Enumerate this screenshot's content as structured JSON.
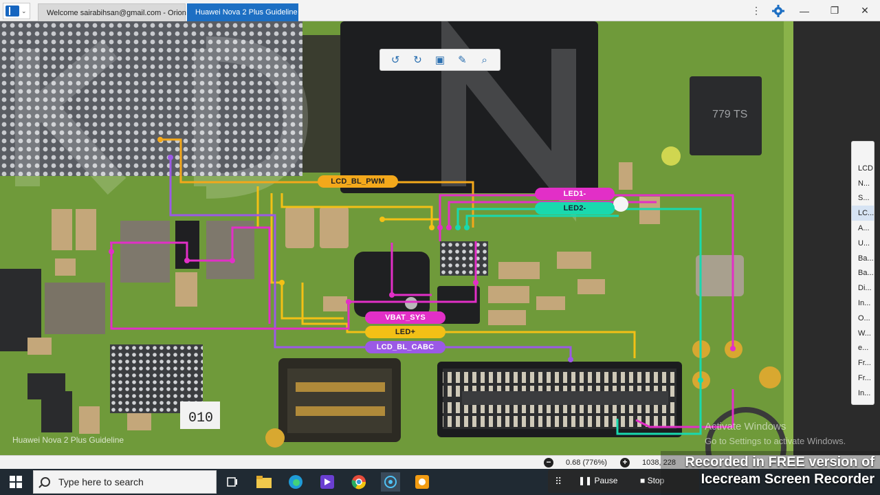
{
  "titlebar": {
    "tabs": [
      {
        "label": "Welcome sairabihsan@gmail.com - Orion"
      },
      {
        "label": "Huawei Nova 2 Plus Guideline",
        "active": true
      }
    ]
  },
  "toolbar": {
    "tools": [
      "rotate-left-icon",
      "rotate-right-icon",
      "fit-screen-icon",
      "brush-icon",
      "search-icon"
    ]
  },
  "net_labels": {
    "lcd_bl_pwm": "LCD_BL_PWM",
    "led1": "LED1-",
    "led2": "LED2-",
    "vbat_sys": "VBAT_SYS",
    "led_plus": "LED+",
    "lcd_bl_cabc": "LCD_BL_CABC"
  },
  "board": {
    "caption": "Huawei Nova 2 Plus Guideline",
    "chip_marking": "779 TS",
    "pad_label": "010"
  },
  "side_list": {
    "items": [
      "LCD",
      "N...",
      "S...",
      "LC...",
      "A...",
      "U...",
      "Ba...",
      "Ba...",
      "Di...",
      "In...",
      "O...",
      "W...",
      "e...",
      "Fr...",
      "Fr...",
      "In..."
    ],
    "selected_index": 3
  },
  "statusbar": {
    "zoom": "0.68 (776%)",
    "coords": "1038, 228"
  },
  "system": {
    "activate_line1": "Activate Windows",
    "activate_line2": "Go to Settings to activate Windows."
  },
  "taskbar": {
    "search_placeholder": "Type here to search"
  },
  "recorder": {
    "pause_label": "Pause",
    "stop_label": "Stop",
    "watermark_line1": "Recorded in FREE version of",
    "watermark_line2": "Icecream  Screen  Recorder"
  },
  "colors": {
    "pwm": "#f3a81b",
    "pink": "#e22fc7",
    "teal": "#19d9ae",
    "yellow": "#f3c016",
    "purple": "#9b59e6",
    "accent": "#1d6fc3",
    "board": "#6f9a3a"
  }
}
